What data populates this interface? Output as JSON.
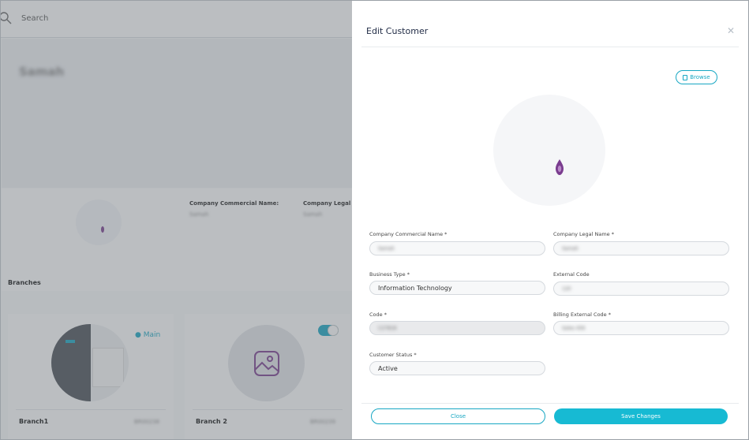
{
  "background": {
    "search_label": "Search",
    "hero_name": "Samah",
    "profile": {
      "commercial_label": "Company Commercial Name:",
      "commercial_value": "Samah",
      "legal_label": "Company Legal Nar",
      "legal_value": "Samah"
    },
    "branches_title": "Branches",
    "branches": [
      {
        "name": "Branch1",
        "code": "BR00238",
        "badge": "Main"
      },
      {
        "name": "Branch 2",
        "code": "BR00239"
      }
    ]
  },
  "modal": {
    "title": "Edit Customer",
    "close_icon": "close-icon",
    "browse_label": "Browse",
    "fields": {
      "commercial_name": {
        "label": "Company Commercial Name *",
        "value": "Samah"
      },
      "legal_name": {
        "label": "Company Legal Name *",
        "value": "Samah"
      },
      "business_type": {
        "label": "Business Type *",
        "value": "Information Technology"
      },
      "external_code": {
        "label": "External Code",
        "value": "120"
      },
      "code": {
        "label": "Code *",
        "value": "C27818"
      },
      "billing_external_code": {
        "label": "Billing External Code *",
        "value": "Sales 456"
      },
      "customer_status": {
        "label": "Customer Status *",
        "value": "Active"
      }
    },
    "close_button": "Close",
    "save_button": "Save Changes"
  },
  "colors": {
    "accent": "#17a7c3",
    "save": "#17bad3",
    "logo_mark": "#7a3c8f",
    "overlay": "#696e76"
  }
}
